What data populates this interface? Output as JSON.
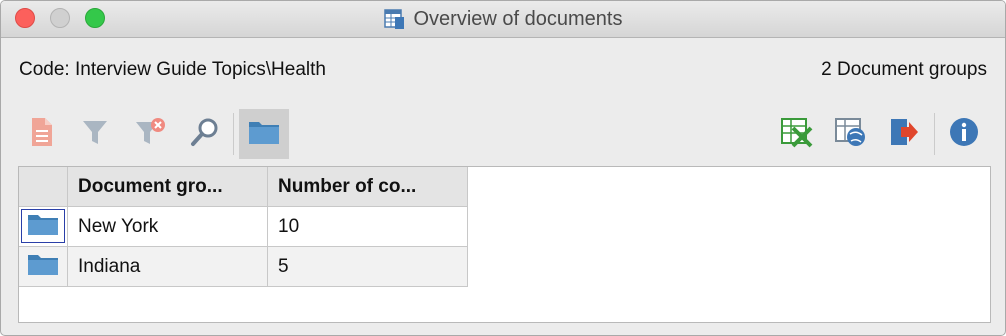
{
  "window": {
    "title": "Overview of documents"
  },
  "header": {
    "code_label": "Code: Interview Guide Topics\\Health",
    "group_count": "2 Document groups"
  },
  "toolbar": {
    "left_icons": [
      "document-icon",
      "filter-icon",
      "remove-filter-icon",
      "search-icon",
      "folder-icon"
    ],
    "right_icons": [
      "excel-export-icon",
      "web-export-icon",
      "export-icon",
      "info-icon"
    ]
  },
  "table": {
    "columns": [
      "Document gro...",
      "Number of co..."
    ],
    "rows": [
      {
        "group": "New York",
        "count": "10"
      },
      {
        "group": "Indiana",
        "count": "5"
      }
    ]
  },
  "colors": {
    "folder": "#5d9bd0",
    "info": "#3d77b6",
    "excel": "#3a9a3a",
    "export_arrow": "#e0462c"
  }
}
